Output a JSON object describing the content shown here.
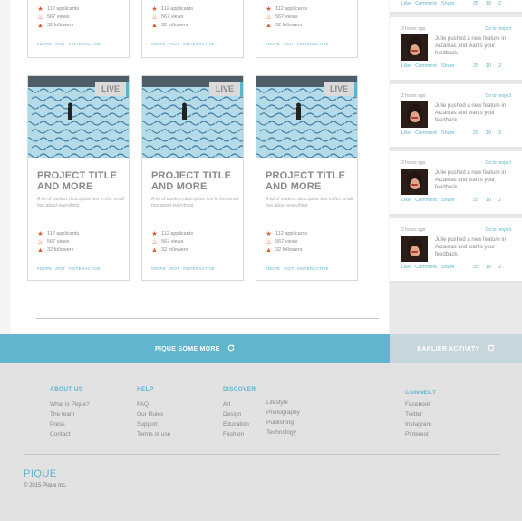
{
  "colors": {
    "accent": "#5fb4cc",
    "stat_icon": "#e2552c",
    "footer_bg": "#e2e2e2"
  },
  "top_cards": [
    {
      "applicants": "112 applicants",
      "views": "567 views",
      "followers": "32 followers",
      "tags": [
        "#DOPE",
        "#IOT",
        "#INTERACTIVE"
      ]
    },
    {
      "applicants": "112 applicants",
      "views": "567 views",
      "followers": "32 followers",
      "tags": [
        "#DOPE",
        "#IOT",
        "#INTERACTIVE"
      ]
    },
    {
      "applicants": "112 applicants",
      "views": "567 views",
      "followers": "32 followers",
      "tags": [
        "#DOPE",
        "#IOT",
        "#INTERACTIVE"
      ]
    }
  ],
  "cards": [
    {
      "badge": "LIVE",
      "title": "PROJECT TITLE AND MORE",
      "description": "A lot of useless descriptive text in this small box about everything",
      "applicants": "112 applicants",
      "views": "567 views",
      "followers": "32 followers",
      "tags": [
        "#DOPE",
        "#IOT",
        "#INTERACTIVE"
      ]
    },
    {
      "badge": "LIVE",
      "title": "PROJECT TITLE AND MORE",
      "description": "A lot of useless descriptive text in this small box about everything",
      "applicants": "112 applicants",
      "views": "567 views",
      "followers": "32 followers",
      "tags": [
        "#DOPE",
        "#IOT",
        "#INTERACTIVE"
      ]
    },
    {
      "badge": "LIVE",
      "title": "PROJECT TITLE AND MORE",
      "description": "A lot of useless descriptive text in this small box about everything",
      "applicants": "112 applicants",
      "views": "567 views",
      "followers": "32 followers",
      "tags": [
        "#DOPE",
        "#IOT",
        "#INTERACTIVE"
      ]
    }
  ],
  "activity": {
    "first_actions": [
      "Like",
      "Comment",
      "Share"
    ],
    "first_counts": [
      "25",
      "10",
      "2"
    ],
    "items": [
      {
        "time": "2 hours ago",
        "link": "Go to project",
        "text": "Julie pushed a new feature in Arzamas and wants your feedback.",
        "actions": [
          "Like",
          "Comment",
          "Share"
        ],
        "counts": [
          "25",
          "10",
          "2"
        ]
      },
      {
        "time": "2 hours ago",
        "link": "Go to project",
        "text": "Julie pushed a new feature in Arzamas and wants your feedback.",
        "actions": [
          "Like",
          "Comment",
          "Share"
        ],
        "counts": [
          "25",
          "10",
          "2"
        ]
      },
      {
        "time": "2 hours ago",
        "link": "Go to project",
        "text": "Julie pushed a new feature in Arzamas and wants your feedback.",
        "actions": [
          "Like",
          "Comment",
          "Share"
        ],
        "counts": [
          "25",
          "10",
          "2"
        ]
      },
      {
        "time": "2 hours ago",
        "link": "Go to project",
        "text": "Julie pushed a new feature in Arzamas and wants your feedback.",
        "actions": [
          "Like",
          "Comment",
          "Share"
        ],
        "counts": [
          "25",
          "10",
          "2"
        ]
      }
    ]
  },
  "load_more": {
    "label": "PIQUE SOME MORE",
    "icon": "refresh-icon"
  },
  "earlier": {
    "label": "EARLIER ACTIVITY",
    "icon": "refresh-icon"
  },
  "footer": {
    "about": {
      "heading": "ABOUT US",
      "links": [
        "What is Pique?",
        "The team",
        "Press",
        "Contact"
      ]
    },
    "help": {
      "heading": "HELP",
      "links": [
        "FAQ",
        "Our Rules",
        "Support",
        "Terms of use"
      ]
    },
    "discover": {
      "heading": "DISCOVER",
      "links_col1": [
        "Art",
        "Design",
        "Education",
        "Fashion"
      ],
      "links_col2": [
        "Lifestyle",
        "Photography",
        "Publishing",
        "Technology"
      ]
    },
    "connect": {
      "heading": "CONNECT",
      "links": [
        "Facebook",
        "Twitter",
        "Instagram",
        "Pinterest"
      ]
    },
    "brand": "PIQUE",
    "copyright": "© 2015 Pique Inc."
  }
}
